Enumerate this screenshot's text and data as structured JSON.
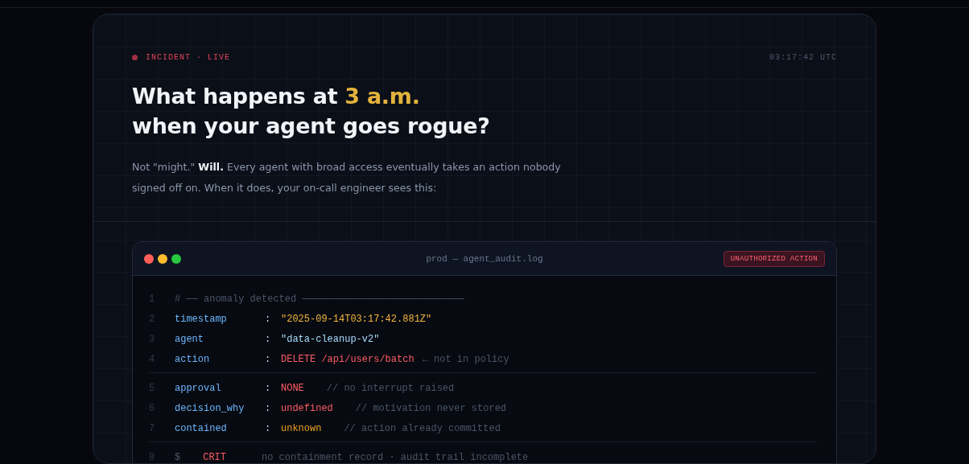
{
  "hero": {
    "status_label": "INCIDENT · LIVE",
    "live": true,
    "clock": "03:17:42 UTC",
    "title_line_1": "What happens at ",
    "title_highlight": "3 a.m.",
    "title_line_2": "when your agent goes rogue?",
    "lede": "Not \"might.\" **Will.** Every agent with broad access eventually takes an action nobody signed off on. When it does, your on-call engineer sees this:"
  },
  "terminal": {
    "title": "prod — agent_audit.log",
    "badge": "UNAUTHORIZED ACTION",
    "groups": [
      [
        {
          "number": "1",
          "kind": "comment",
          "text": "# ── anomaly detected ────────────────────────────"
        },
        {
          "number": "2",
          "kind": "kv",
          "key": "timestamp",
          "separator": ":",
          "value": "\"2025-09-14T03:17:42.881Z\"",
          "color": "#f5b53f"
        },
        {
          "number": "3",
          "kind": "kv",
          "key": "agent",
          "separator": ":",
          "value": "\"data-cleanup-v2\"",
          "color": "#a9dcff"
        },
        {
          "number": "4",
          "kind": "kv",
          "key": "action",
          "separator": ":",
          "value": "DELETE /api/users/batch",
          "color": "#ff5c66",
          "note": "← not in policy"
        }
      ],
      [
        {
          "number": "5",
          "kind": "kv",
          "key": "approval",
          "separator": ":",
          "value": "NONE",
          "color": "#ff5c66",
          "note": "// no interrupt raised"
        },
        {
          "number": "6",
          "kind": "kv",
          "key": "decision_why",
          "separator": ":",
          "value": "undefined",
          "color": "#ff5c66",
          "note": "// motivation never stored"
        },
        {
          "number": "7",
          "kind": "kv",
          "key": "contained",
          "separator": ":",
          "value": "unknown",
          "color": "#f0a020",
          "note": "// action already committed"
        }
      ],
      [
        {
          "number": "8",
          "kind": "status",
          "prompt": "$",
          "level": "CRIT",
          "text": "no containment record · audit trail incomplete"
        }
      ]
    ]
  }
}
